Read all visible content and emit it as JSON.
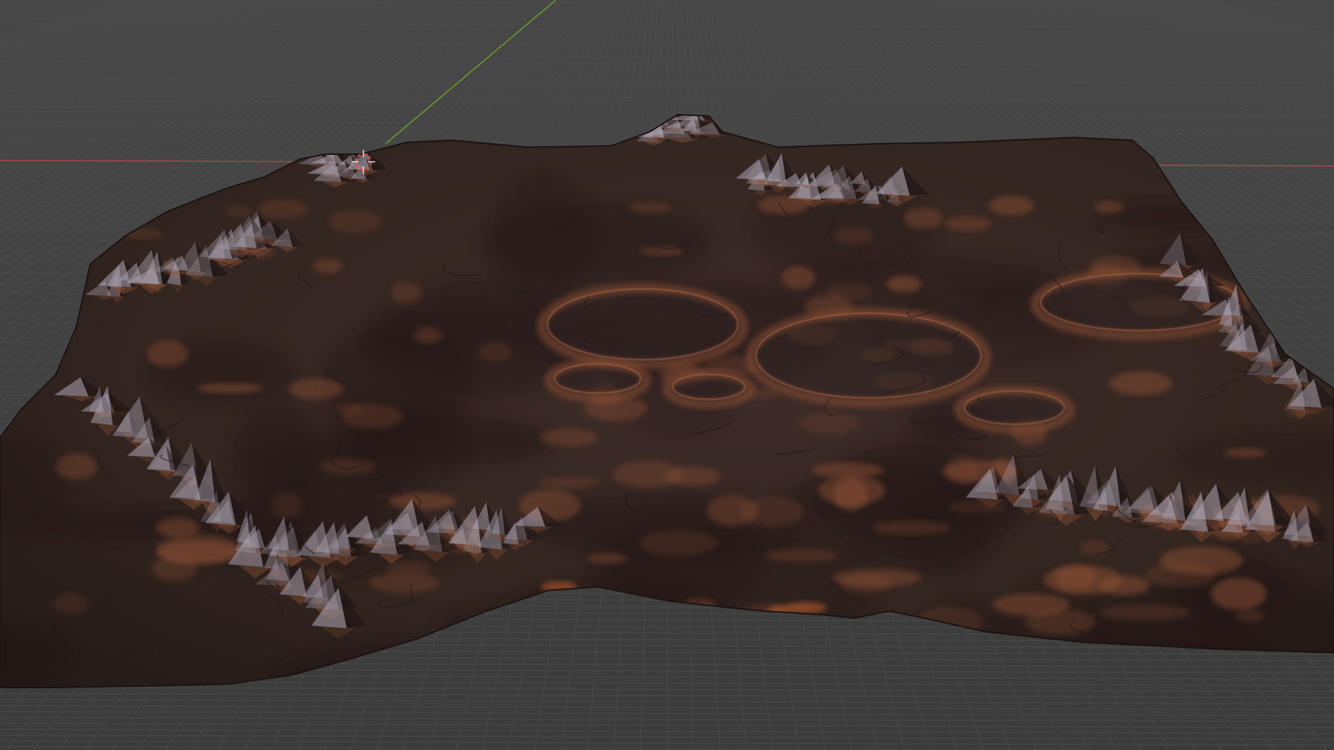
{
  "viewport": {
    "colors": {
      "floor": "#3d3d3d",
      "floor_far": "#454545",
      "grid_line": "#4c4c4c",
      "x_axis": "#b8474f",
      "y_axis": "#6f9e2e",
      "terrain_base": "#3b2b28",
      "terrain_mid": "#2f2321",
      "terrain_rust": "#8a5036",
      "terrain_highlight": "#a79fac",
      "terrain_shadow": "#201716",
      "cursor_red": "#d84b3d",
      "cursor_white": "#f2f2f2"
    },
    "terrain": {
      "icon": "terrain-mesh-icon"
    },
    "cursor": {
      "icon": "3d-cursor-icon"
    }
  }
}
